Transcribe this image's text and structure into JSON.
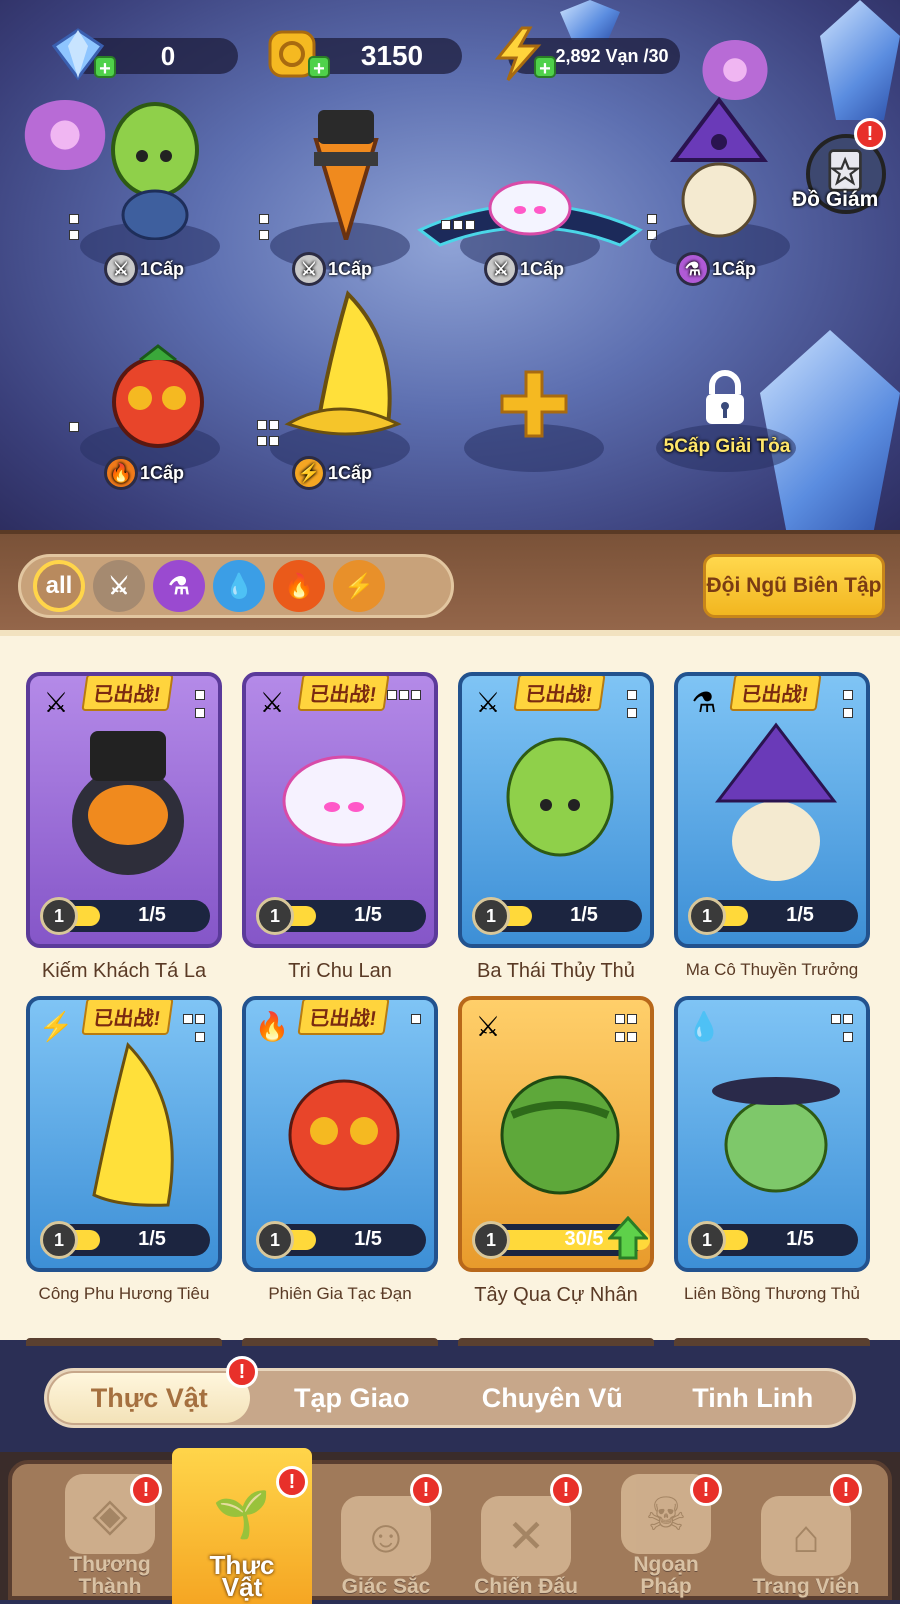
{
  "resources": {
    "gems": "0",
    "coins": "3150",
    "energy": "2,892 Vạn /30"
  },
  "collection_label": "Đồ Giám",
  "team": {
    "slots": [
      {
        "level": "1Cấp",
        "element": "sword"
      },
      {
        "level": "1Cấp",
        "element": "sword"
      },
      {
        "level": "1Cấp",
        "element": "sword"
      },
      {
        "level": "1Cấp",
        "element": "potion"
      },
      {
        "level": "1Cấp",
        "element": "fire"
      },
      {
        "level": "1Cấp",
        "element": "lightning"
      }
    ],
    "add_slot_icon": "plus-icon",
    "locked_label": "5Cấp Giải Tỏa"
  },
  "filters": {
    "all_label": "all",
    "items": [
      "sword-icon",
      "potion-icon",
      "water-icon",
      "fire-icon",
      "lightning-icon"
    ]
  },
  "edit_team_button": "Đội Ngũ Biên Tập",
  "cards": [
    {
      "name": "Kiếm Khách Tá La",
      "level": "1",
      "progress": "1/5",
      "progress_value": 0.2,
      "deployed": "已出战!",
      "rarity": "purple",
      "element": "⚔"
    },
    {
      "name": "Tri Chu Lan",
      "level": "1",
      "progress": "1/5",
      "progress_value": 0.2,
      "deployed": "已出战!",
      "rarity": "purple",
      "element": "⚔"
    },
    {
      "name": "Ba Thái Thủy Thủ",
      "level": "1",
      "progress": "1/5",
      "progress_value": 0.2,
      "deployed": "已出战!",
      "rarity": "blue",
      "element": "⚔"
    },
    {
      "name": "Ma Cô Thuyền Trưởng",
      "level": "1",
      "progress": "1/5",
      "progress_value": 0.2,
      "deployed": "已出战!",
      "rarity": "blue",
      "element": "⚗"
    },
    {
      "name": "Công Phu Hương Tiêu",
      "level": "1",
      "progress": "1/5",
      "progress_value": 0.2,
      "deployed": "已出战!",
      "rarity": "blue",
      "element": "⚡"
    },
    {
      "name": "Phiên Gia Tạc Đạn",
      "level": "1",
      "progress": "1/5",
      "progress_value": 0.2,
      "deployed": "已出战!",
      "rarity": "blue",
      "element": "🔥"
    },
    {
      "name": "Tây Qua Cự Nhân",
      "level": "1",
      "progress": "30/5",
      "progress_value": 1.0,
      "deployed": "",
      "rarity": "gold",
      "element": "⚔"
    },
    {
      "name": "Liên Bồng Thương Thủ",
      "level": "1",
      "progress": "1/5",
      "progress_value": 0.2,
      "deployed": "",
      "rarity": "blue",
      "element": "💧"
    }
  ],
  "category_tabs": [
    "Thực Vật",
    "Tạp Giao",
    "Chuyên Vũ",
    "Tinh Linh"
  ],
  "active_category": "Thực Vật",
  "bottom_nav": [
    {
      "label": "Thương Thành",
      "icon": "shop-icon"
    },
    {
      "label": "Thực Vật",
      "icon": "plants-icon"
    },
    {
      "label": "Giác Sắc",
      "icon": "character-icon"
    },
    {
      "label": "Chiến Đấu",
      "icon": "battle-icon"
    },
    {
      "label": "Ngoạn Pháp",
      "icon": "gameplay-icon"
    },
    {
      "label": "Trang Viên",
      "icon": "manor-icon"
    }
  ],
  "colors": {
    "accent": "#f5b921",
    "panel": "#94664a",
    "card_bg": "#fbf3df",
    "alert": "#e8302a"
  }
}
